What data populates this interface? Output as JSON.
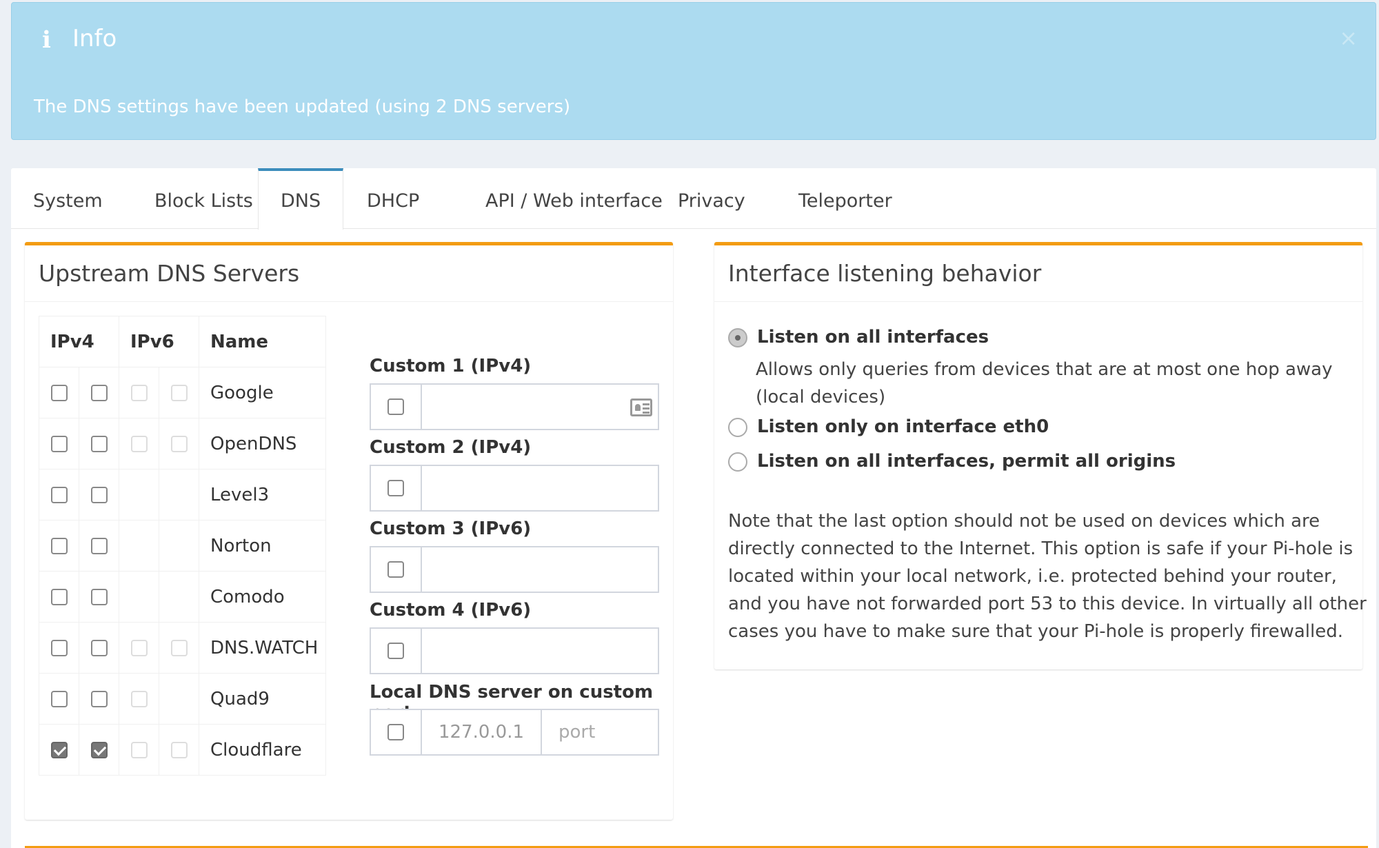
{
  "alert": {
    "title": "Info",
    "message": "The DNS settings have been updated (using 2 DNS servers)",
    "close": "×"
  },
  "tabs": [
    {
      "label": "System"
    },
    {
      "label": "Block Lists"
    },
    {
      "label": "DNS",
      "active": true
    },
    {
      "label": "DHCP"
    },
    {
      "label": "API / Web interface"
    },
    {
      "label": "Privacy"
    },
    {
      "label": "Teleporter"
    }
  ],
  "upstream": {
    "title": "Upstream DNS Servers",
    "headers": {
      "ipv4": "IPv4",
      "ipv6": "IPv6",
      "name": "Name"
    },
    "servers": [
      {
        "name": "Google",
        "v4a": false,
        "v4b": false,
        "v6a": false,
        "v6b": false
      },
      {
        "name": "OpenDNS",
        "v4a": false,
        "v4b": false,
        "v6a": false,
        "v6b": false
      },
      {
        "name": "Level3",
        "v4a": false,
        "v4b": false
      },
      {
        "name": "Norton",
        "v4a": false,
        "v4b": false
      },
      {
        "name": "Comodo",
        "v4a": false,
        "v4b": false
      },
      {
        "name": "DNS.WATCH",
        "v4a": false,
        "v4b": false,
        "v6a": false,
        "v6b": false
      },
      {
        "name": "Quad9",
        "v4a": false,
        "v4b": false,
        "v6a": false
      },
      {
        "name": "Cloudflare",
        "v4a": true,
        "v4b": true,
        "v6a": false,
        "v6b": false
      }
    ],
    "custom": [
      {
        "label": "Custom 1 (IPv4)"
      },
      {
        "label": "Custom 2 (IPv4)"
      },
      {
        "label": "Custom 3 (IPv6)"
      },
      {
        "label": "Custom 4 (IPv6)"
      }
    ],
    "local": {
      "label": "Local DNS server on custom port",
      "ip": "127.0.0.1",
      "port_placeholder": "port"
    }
  },
  "interface": {
    "title": "Interface listening behavior",
    "options": [
      {
        "label": "Listen on all interfaces",
        "selected": true
      },
      {
        "label": "Listen only on interface eth0",
        "selected": false
      },
      {
        "label": "Listen on all interfaces, permit all origins",
        "selected": false
      }
    ],
    "option1_desc": "Allows only queries from devices that are at most one hop away (local devices)",
    "note": "Note that the last option should not be used on devices which are directly connected to the Internet. This option is safe if your Pi-hole is located within your local network, i.e. protected behind your router, and you have not forwarded port 53 to this device. In virtually all other cases you have to make sure that your Pi-hole is properly firewalled."
  },
  "colors": {
    "accent": "#3c8dbc",
    "box_border": "#f39c12",
    "alert_bg": "#acdbf0"
  }
}
